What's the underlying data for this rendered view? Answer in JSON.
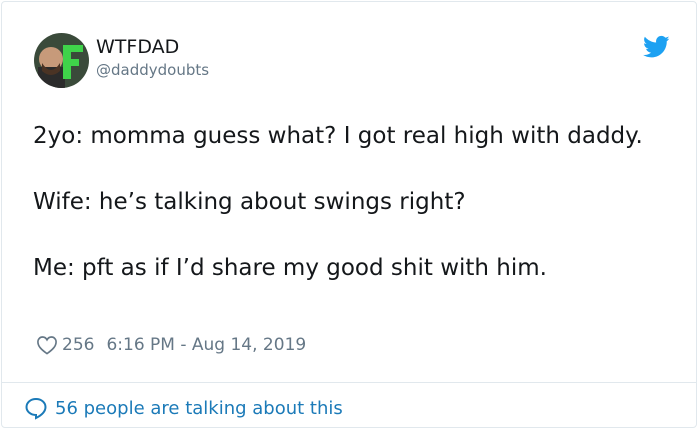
{
  "tweet": {
    "display_name": "WTFDAD",
    "handle": "@daddydoubts",
    "lines": [
      "2yo: momma guess what? I got real high with daddy.",
      "Wife: he’s talking about swings right?",
      "Me: pft as if I’d share my good shit with him."
    ],
    "likes": "256",
    "timestamp": "6:16 PM - Aug 14, 2019",
    "talking": "56 people are talking about this"
  },
  "icons": {
    "avatar": "avatar-icon",
    "brand": "twitter-bird-icon",
    "like": "heart-icon",
    "reply": "speech-bubble-icon"
  },
  "colors": {
    "brand_blue": "#1da1f2",
    "link_blue": "#1b7ab8",
    "secondary_text": "#657786",
    "primary_text": "#14171a",
    "border": "#e1e8ed"
  }
}
